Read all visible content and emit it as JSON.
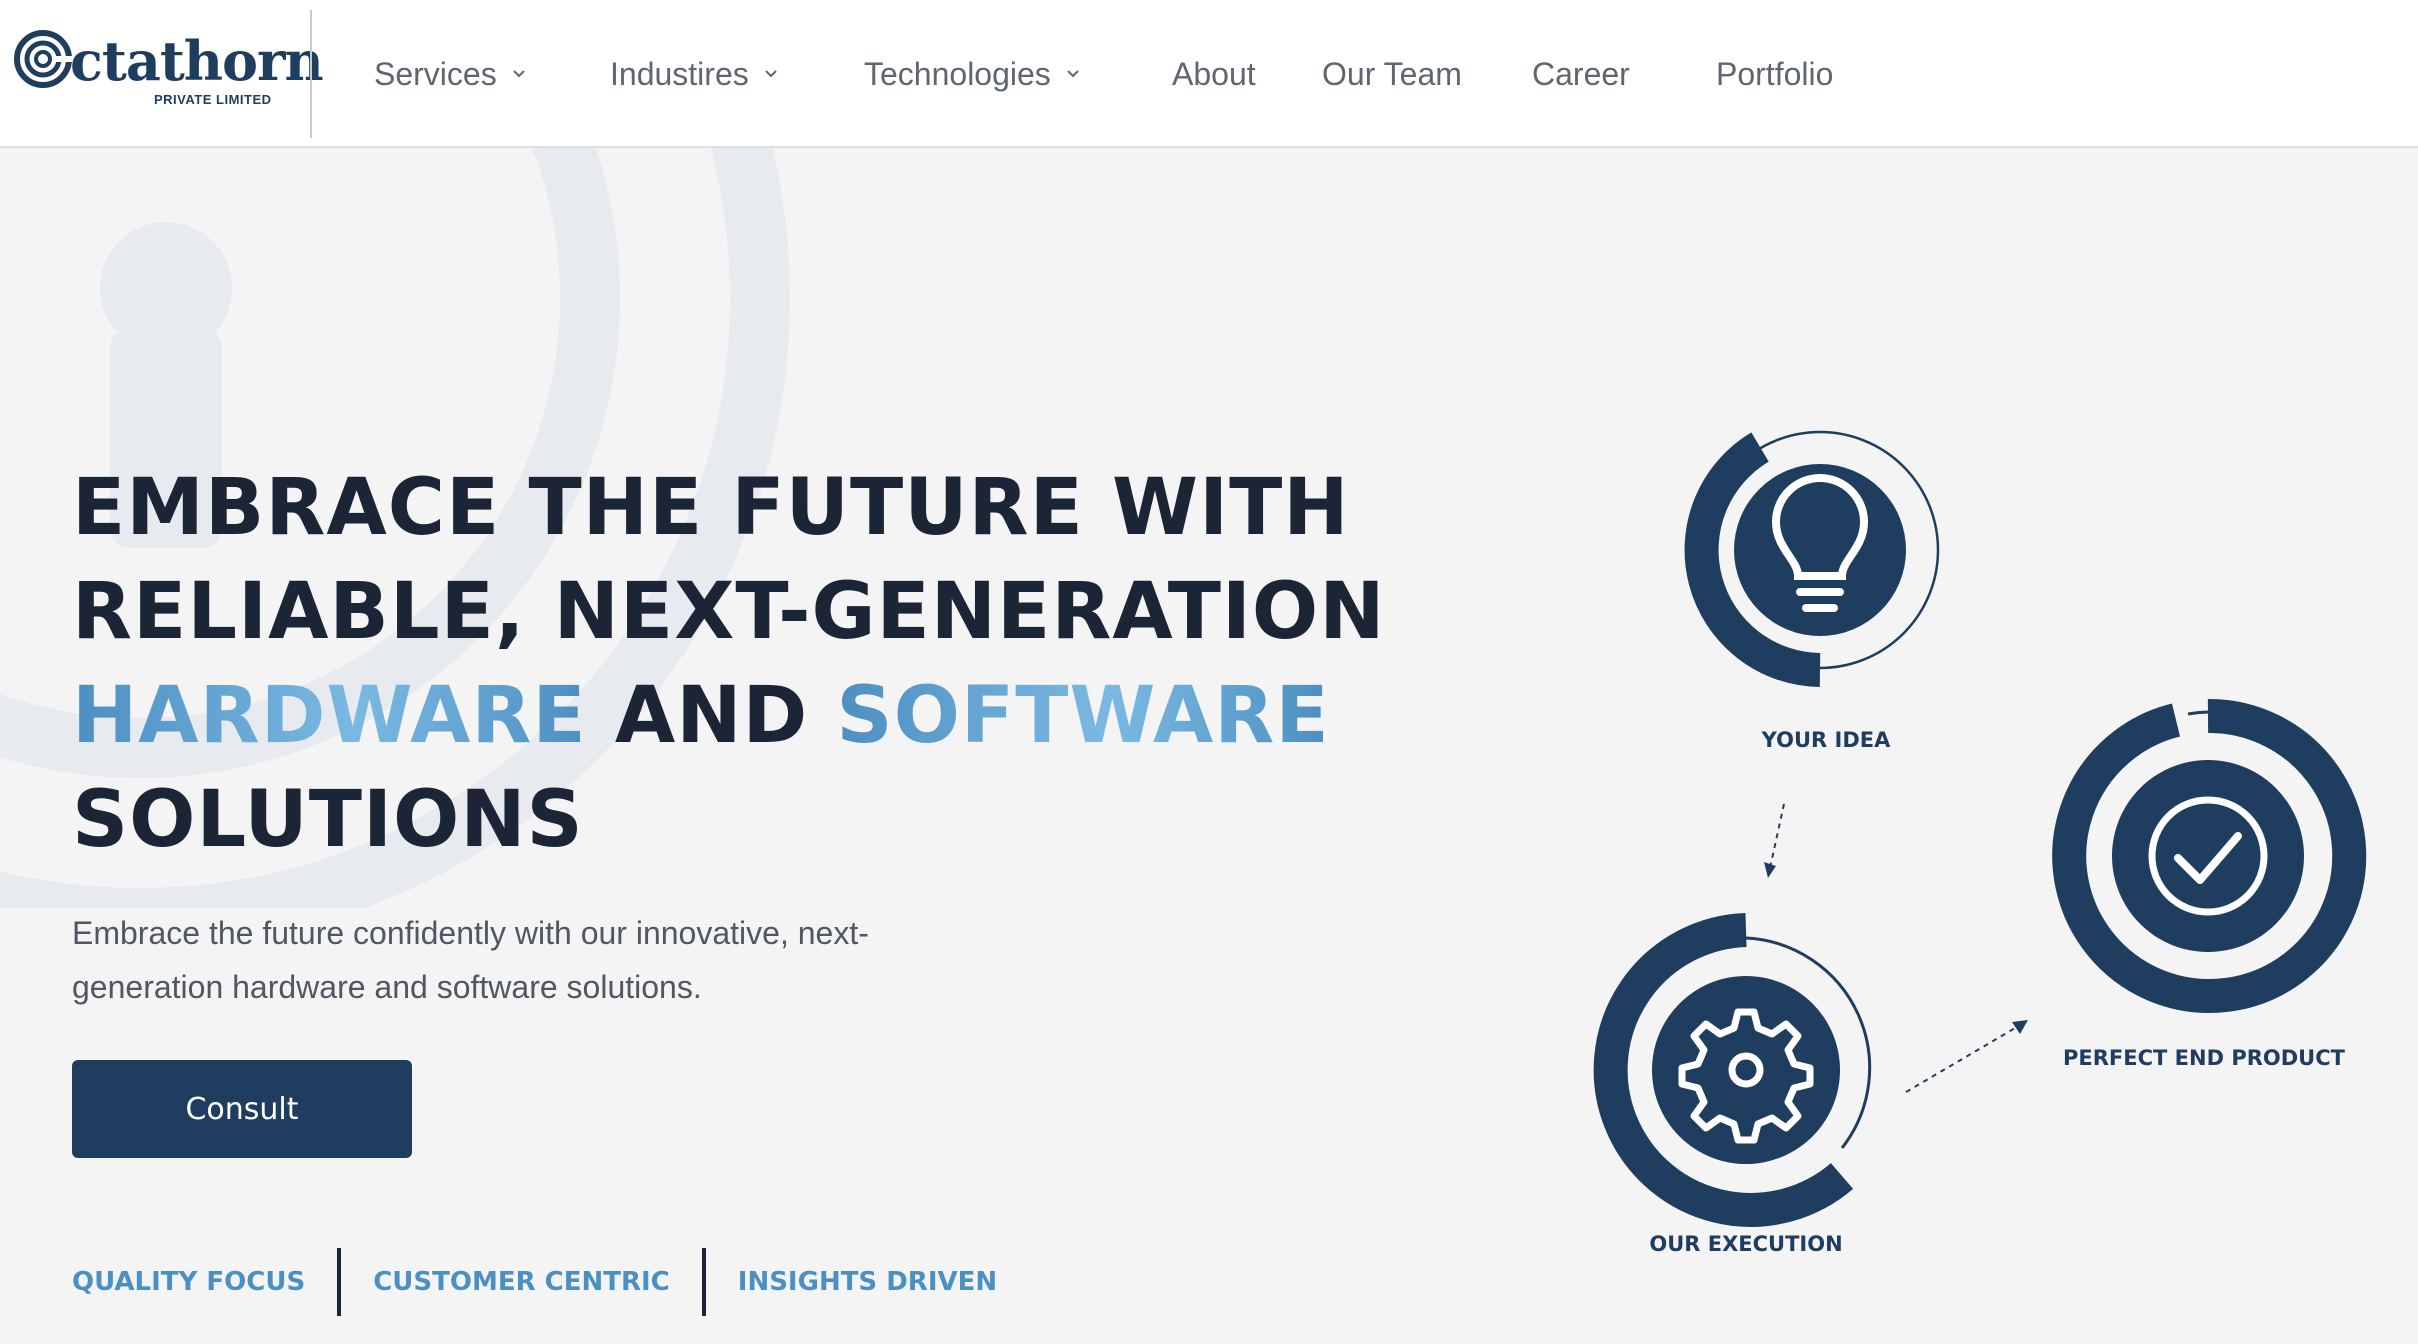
{
  "brand": {
    "name": "Octathorn",
    "name_rest": "ctathorn",
    "tagline": "PRIVATE LIMITED",
    "color": "#1f3d5e"
  },
  "nav": {
    "items": [
      {
        "label": "Services",
        "has_dropdown": true
      },
      {
        "label": "Industires",
        "has_dropdown": true
      },
      {
        "label": "Technologies",
        "has_dropdown": true
      },
      {
        "label": "About",
        "has_dropdown": false
      },
      {
        "label": "Our Team",
        "has_dropdown": false
      },
      {
        "label": "Career",
        "has_dropdown": false
      },
      {
        "label": "Portfolio",
        "has_dropdown": false
      }
    ]
  },
  "hero": {
    "title_line1": "EMBRACE THE FUTURE WITH",
    "title_line2": "RELIABLE, NEXT-GENERATION",
    "title_hl1": "HARDWARE",
    "title_and": "AND",
    "title_hl2": "SOFTWARE",
    "title_line4": "SOLUTIONS",
    "subtitle_line1": "Embrace the future confidently with our innovative, next-",
    "subtitle_line2": "generation hardware and software solutions.",
    "cta_label": "Consult",
    "tags": [
      "QUALITY FOCUS",
      "CUSTOMER CENTRIC",
      "INSIGHTS DRIVEN"
    ]
  },
  "process": {
    "steps": [
      {
        "label": "YOUR IDEA",
        "icon": "lightbulb-icon"
      },
      {
        "label": "OUR EXECUTION",
        "icon": "gear-icon"
      },
      {
        "label": "PERFECT END PRODUCT",
        "icon": "checkmark-icon"
      }
    ]
  },
  "colors": {
    "primary": "#1f3d5e",
    "accent": "#4a90c2",
    "background": "#f4f4f5",
    "text": "#1c2536"
  }
}
